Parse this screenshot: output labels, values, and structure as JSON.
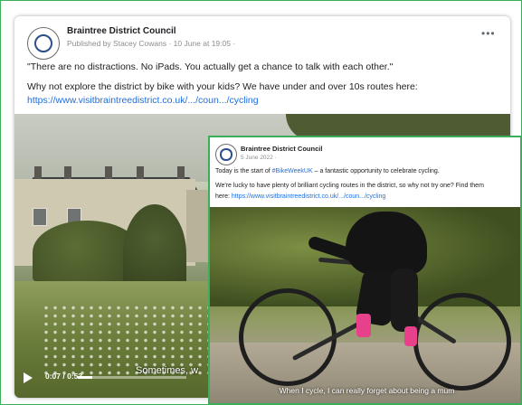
{
  "back_post": {
    "page_name": "Braintree District Council",
    "meta": "Published by Stacey Cowans · 10 June at 19:05 ·",
    "line1": "\"There are no distractions. No iPads. You actually get a chance to talk with each other.\"",
    "line2": "Why not explore the district by bike with your kids? We have under and over 10s routes here:",
    "link": "https://www.visitbraintreedistrict.co.uk/.../coun.../cycling",
    "more_icon": "more-dots-icon",
    "video": {
      "time": "0:07 / 0:53",
      "caption": "Sometimes, w",
      "progress": 0.13
    }
  },
  "front_post": {
    "page_name": "Braintree District Council",
    "meta": "5 June 2022 ·",
    "line1_prefix": "Today is the start of ",
    "hashtag": "#BikeWeekUK",
    "line1_suffix": " – a fantastic opportunity to celebrate cycling.",
    "line2": "We're lucky to have plenty of brilliant cycling routes in the district, so why not try one? Find them",
    "line3_prefix": "here: ",
    "link": "https://www.visitbraintreedistrict.co.uk/.../coun.../cycling",
    "video": {
      "caption": "When I cycle, I can really forget about being a mum"
    }
  },
  "colors": {
    "highlight_border": "#3cae5a",
    "link": "#216fdb",
    "text": "#1c1e21",
    "meta": "#8a8d91"
  }
}
